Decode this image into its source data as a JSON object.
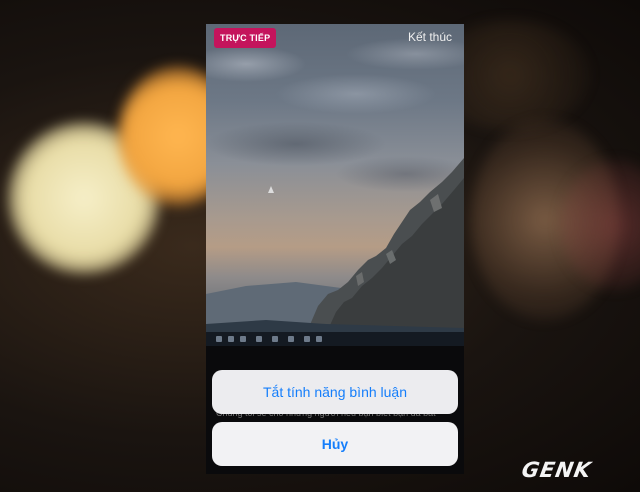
{
  "live_badge": "TRỰC TIẾP",
  "end_label": "Kết thúc",
  "obscured_text": "Chúng tôi sẽ cho những người nếu bạn biết bạn đã bắt",
  "action_sheet": {
    "turn_off_comments": "Tắt tính năng bình luận",
    "cancel": "Hủy"
  },
  "watermark": "GENK",
  "colors": {
    "live_badge": "#c4145c",
    "action_text": "#157efb",
    "button_bg": "#f2f2f4"
  },
  "icons": [
    "mouse-cursor-icon"
  ]
}
